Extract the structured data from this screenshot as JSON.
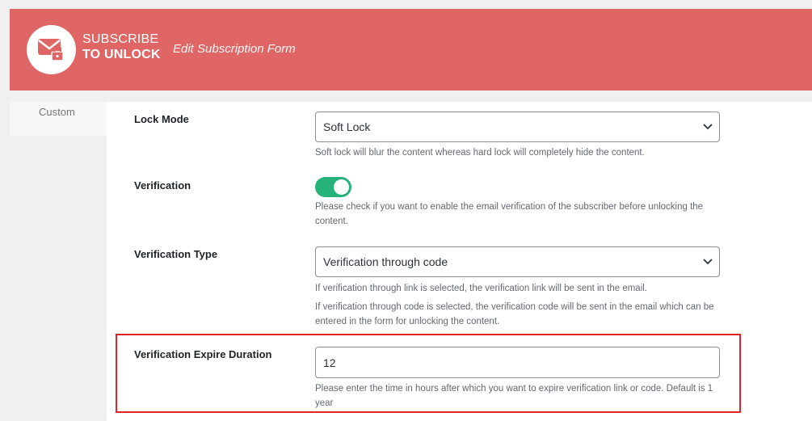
{
  "header": {
    "brand_line1": "SUBSCRIBE",
    "brand_line2": "TO UNLOCK",
    "subtitle": "Edit Subscription Form",
    "color": "#e06666"
  },
  "sidebar": {
    "partial_item_label": "Custom"
  },
  "fields": {
    "lock_mode": {
      "label": "Lock Mode",
      "value": "Soft Lock",
      "help": "Soft lock will blur the content whereas hard lock will completely hide the content."
    },
    "verification": {
      "label": "Verification",
      "enabled": true,
      "help": "Please check if you want to enable the email verification of the subscriber before unlocking the content."
    },
    "verification_type": {
      "label": "Verification Type",
      "value": "Verification through code",
      "help_link": "If verification through link is selected, the verification link will be sent in the email.",
      "help_code": "If verification through code is selected, the verification code will be sent in the email which can be entered in the form for unlocking the content."
    },
    "verification_expire_duration": {
      "label": "Verification Expire Duration",
      "value": "12",
      "help": "Please enter the time in hours after which you want to expire verification link or code. Default is 1 year"
    }
  },
  "colors": {
    "toggle_on": "#26b27a",
    "highlight_border": "#e02424"
  }
}
